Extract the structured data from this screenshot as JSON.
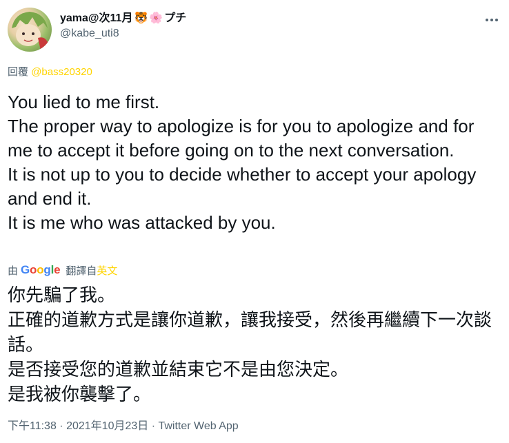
{
  "author": {
    "display_name": "yama@次11月",
    "display_name_suffix": "プチ",
    "emoji_1": "🐯",
    "emoji_2": "🌸",
    "handle": "@kabe_uti8",
    "avatar_icon": "avatar-illustration"
  },
  "reply": {
    "prefix": "回覆",
    "mention": "@bass20320"
  },
  "tweet": {
    "lines": [
      "You lied to me first.",
      "The proper way to apologize is for you to apologize and for me to accept it before going on to the next conversation.",
      "It is not up to you to decide whether to accept your apology and end it.",
      "It is me who was attacked by you."
    ]
  },
  "translation": {
    "by": "由",
    "engine_letters": [
      "G",
      "o",
      "o",
      "g",
      "l",
      "e"
    ],
    "translated_from": "翻譯自",
    "source_lang": "英文",
    "lines": [
      "你先騙了我。",
      "正確的道歉方式是讓你道歉，讓我接受，然後再繼續下一次談話。",
      "是否接受您的道歉並結束它不是由您決定。",
      "是我被你襲擊了。"
    ]
  },
  "meta": {
    "text": "下午11:38 · 2021年10月23日 · Twitter Web App"
  },
  "colors": {
    "text_primary": "#0f1419",
    "text_secondary": "#536471",
    "accent": "#ffd400"
  }
}
